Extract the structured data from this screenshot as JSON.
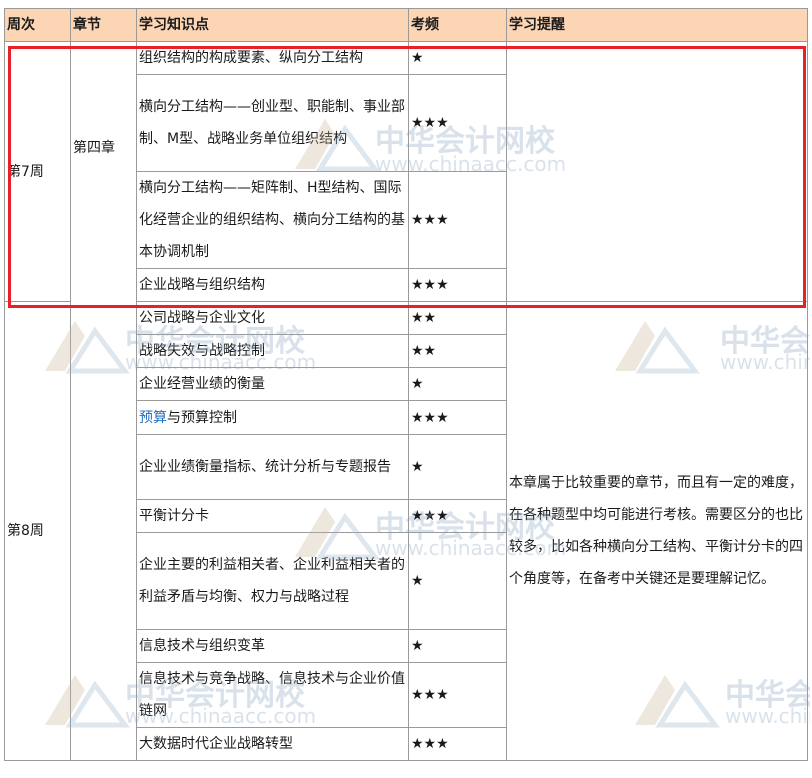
{
  "headers": {
    "week": "周次",
    "chapter": "章节",
    "topic": "学习知识点",
    "freq": "考频",
    "tip": "学习提醒"
  },
  "chapter": "第四章",
  "weeks": [
    {
      "label": "第7周"
    },
    {
      "label": "第8周"
    }
  ],
  "rows": [
    {
      "topic": "组织结构的构成要素、纵向分工结构",
      "stars": "★"
    },
    {
      "topic": "横向分工结构——创业型、职能制、事业部制、M型、战略业务单位组织结构",
      "stars": "★★★"
    },
    {
      "topic": "横向分工结构——矩阵制、H型结构、国际化经营企业的组织结构、横向分工结构的基本协调机制",
      "stars": "★★★"
    },
    {
      "topic": "企业战略与组织结构",
      "stars": "★★★"
    },
    {
      "topic": "公司战略与企业文化",
      "stars": "★★"
    },
    {
      "topic": "战略失效与战略控制",
      "stars": "★★"
    },
    {
      "topic": "企业经营业绩的衡量",
      "stars": "★"
    },
    {
      "topic_link": "预算",
      "topic": "与预算控制",
      "stars": "★★★"
    },
    {
      "topic": "企业业绩衡量指标、统计分析与专题报告",
      "stars": "★"
    },
    {
      "topic": "平衡计分卡",
      "stars": "★★★"
    },
    {
      "topic": "企业主要的利益相关者、企业利益相关者的利益矛盾与均衡、权力与战略过程",
      "stars": "★"
    },
    {
      "topic": "信息技术与组织变革",
      "stars": "★"
    },
    {
      "topic": "信息技术与竞争战略、信息技术与企业价值链网",
      "stars": "★★★"
    },
    {
      "topic": "大数据时代企业战略转型",
      "stars": "★★★"
    }
  ],
  "tip_text": "本章属于比较重要的章节，而且有一定的难度，在各种题型中均可能进行考核。需要区分的也比较多，比如各种横向分工结构、平衡计分卡的四个角度等，在备考中关键还是要理解记忆。",
  "watermark": {
    "cn": "中华会计网校",
    "url": "www.chinaacc.com"
  },
  "colors": {
    "header_bg": "#fcd5b4",
    "highlight_border": "#e8202a",
    "link": "#1f6fbf",
    "border": "#9a9a9a"
  }
}
